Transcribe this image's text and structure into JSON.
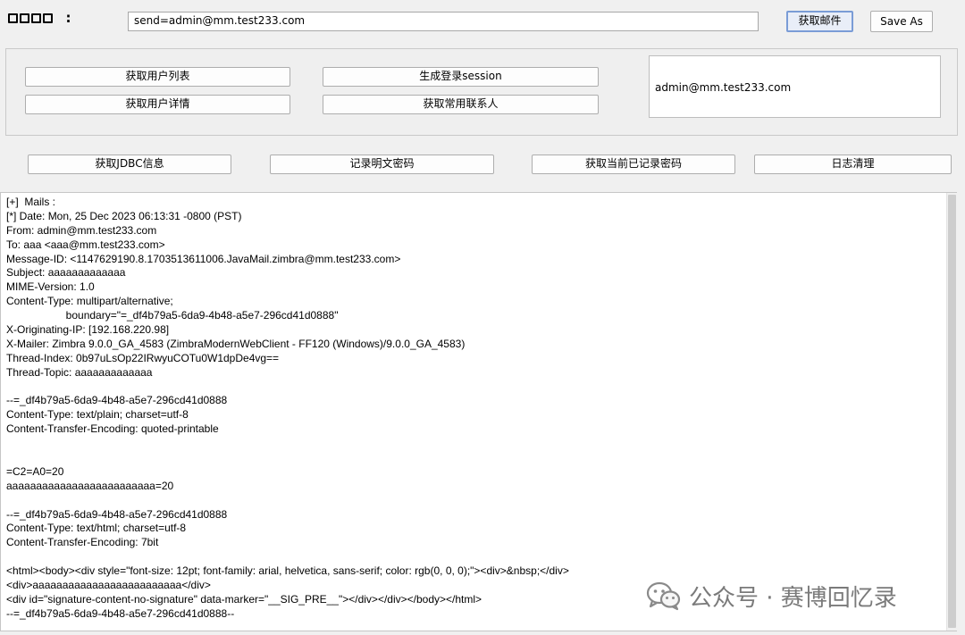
{
  "top_bar": {
    "label": "□□□□ :",
    "input_value": "send=admin@mm.test233.com",
    "get_mail_button": "获取邮件",
    "save_as_button": "Save As"
  },
  "group1": {
    "buttons": [
      "获取用户列表",
      "生成登录session",
      "获取用户详情",
      "获取常用联系人"
    ],
    "info_text": "admin@mm.test233.com"
  },
  "row2": {
    "buttons": [
      "获取JDBC信息",
      "记录明文密码",
      "获取当前已记录密码",
      "日志清理"
    ]
  },
  "log": {
    "lines": [
      "[+]  Mails :",
      "[*] Date: Mon, 25 Dec 2023 06:13:31 -0800 (PST)",
      "From: admin@mm.test233.com",
      "To: aaa <aaa@mm.test233.com>",
      "Message-ID: <1147629190.8.1703513611006.JavaMail.zimbra@mm.test233.com>",
      "Subject: aaaaaaaaaaaaa",
      "MIME-Version: 1.0",
      "Content-Type: multipart/alternative;",
      "                    boundary=\"=_df4b79a5-6da9-4b48-a5e7-296cd41d0888\"",
      "X-Originating-IP: [192.168.220.98]",
      "X-Mailer: Zimbra 9.0.0_GA_4583 (ZimbraModernWebClient - FF120 (Windows)/9.0.0_GA_4583)",
      "Thread-Index: 0b97uLsOp22IRwyuCOTu0W1dpDe4vg==",
      "Thread-Topic: aaaaaaaaaaaaa",
      "",
      "--=_df4b79a5-6da9-4b48-a5e7-296cd41d0888",
      "Content-Type: text/plain; charset=utf-8",
      "Content-Transfer-Encoding: quoted-printable",
      "",
      "",
      "=C2=A0=20",
      "aaaaaaaaaaaaaaaaaaaaaaaaa=20",
      "",
      "--=_df4b79a5-6da9-4b48-a5e7-296cd41d0888",
      "Content-Type: text/html; charset=utf-8",
      "Content-Transfer-Encoding: 7bit",
      "",
      "<html><body><div style=\"font-size: 12pt; font-family: arial, helvetica, sans-serif; color: rgb(0, 0, 0);\"><div>&nbsp;</div>",
      "<div>aaaaaaaaaaaaaaaaaaaaaaaaa</div>",
      "<div id=\"signature-content-no-signature\" data-marker=\"__SIG_PRE__\"></div></div></body></html>",
      "--=_df4b79a5-6da9-4b48-a5e7-296cd41d0888--"
    ]
  },
  "watermark": {
    "text": "公众号 · 赛博回忆录",
    "icon": "wechat-icon"
  }
}
